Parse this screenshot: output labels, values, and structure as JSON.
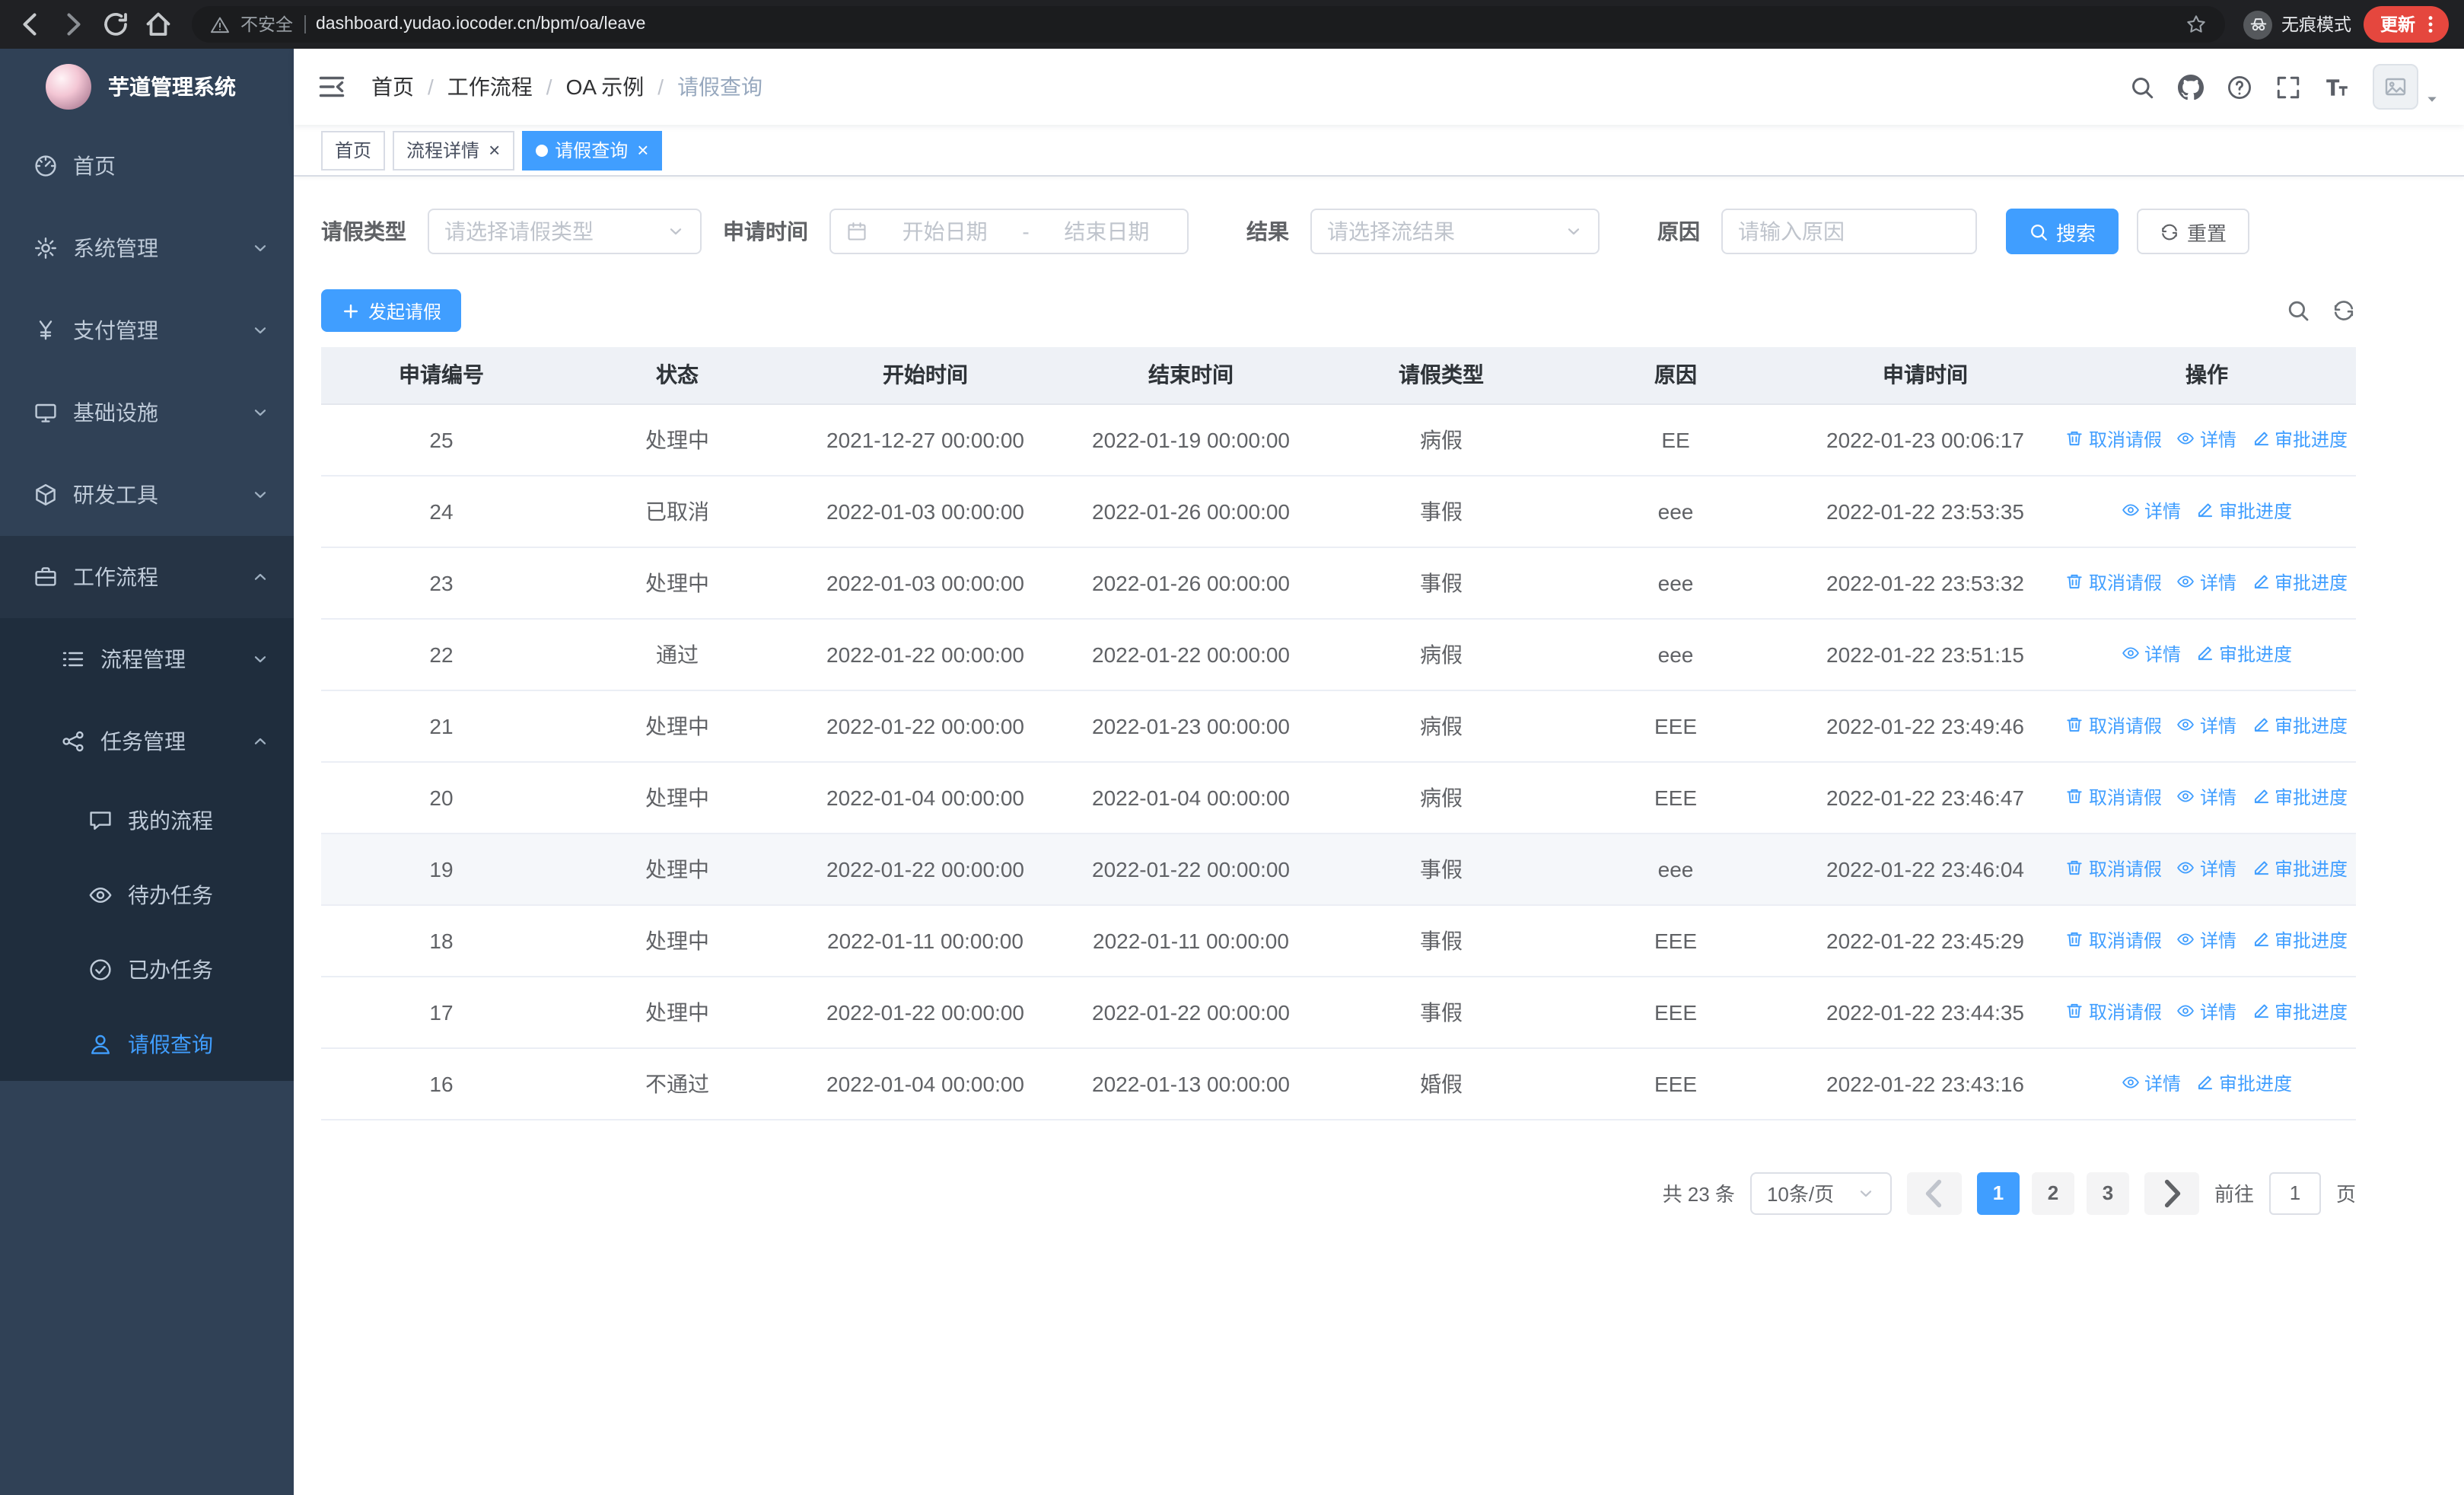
{
  "browser": {
    "security_label": "不安全",
    "url": "dashboard.yudao.iocoder.cn/bpm/oa/leave",
    "incognito_label": "无痕模式",
    "update_label": "更新"
  },
  "sidebar": {
    "app_title": "芋道管理系统",
    "items": [
      {
        "key": "home",
        "label": "首页",
        "icon": "dashboard",
        "level": 1,
        "expandable": false,
        "expanded": false,
        "active": false
      },
      {
        "key": "system-management",
        "label": "系统管理",
        "icon": "gear",
        "level": 1,
        "expandable": true,
        "expanded": false,
        "active": false
      },
      {
        "key": "payment-management",
        "label": "支付管理",
        "icon": "yen",
        "level": 1,
        "expandable": true,
        "expanded": false,
        "active": false
      },
      {
        "key": "infrastructure",
        "label": "基础设施",
        "icon": "monitor",
        "level": 1,
        "expandable": true,
        "expanded": false,
        "active": false
      },
      {
        "key": "dev-tools",
        "label": "研发工具",
        "icon": "cube",
        "level": 1,
        "expandable": true,
        "expanded": false,
        "active": false
      },
      {
        "key": "workflow",
        "label": "工作流程",
        "icon": "briefcase",
        "level": 1,
        "expandable": true,
        "expanded": true,
        "active": false
      },
      {
        "key": "process-management",
        "label": "流程管理",
        "icon": "list",
        "level": 2,
        "expandable": true,
        "expanded": false,
        "active": false
      },
      {
        "key": "task-management",
        "label": "任务管理",
        "icon": "share",
        "level": 2,
        "expandable": true,
        "expanded": true,
        "active": false
      },
      {
        "key": "my-process",
        "label": "我的流程",
        "icon": "chat",
        "level": 3,
        "expandable": false,
        "expanded": false,
        "active": false
      },
      {
        "key": "todo-tasks",
        "label": "待办任务",
        "icon": "eye",
        "level": 3,
        "expandable": false,
        "expanded": false,
        "active": false
      },
      {
        "key": "done-tasks",
        "label": "已办任务",
        "icon": "check",
        "level": 3,
        "expandable": false,
        "expanded": false,
        "active": false
      },
      {
        "key": "leave-query",
        "label": "请假查询",
        "icon": "user",
        "level": 3,
        "expandable": false,
        "expanded": false,
        "active": true
      }
    ]
  },
  "header": {
    "breadcrumb": [
      "首页",
      "工作流程",
      "OA 示例",
      "请假查询"
    ],
    "breadcrumb_separator": "/"
  },
  "tabs": [
    {
      "key": "home",
      "label": "首页",
      "closable": false,
      "active": false
    },
    {
      "key": "process-detail",
      "label": "流程详情",
      "closable": true,
      "active": false
    },
    {
      "key": "leave-query",
      "label": "请假查询",
      "closable": true,
      "active": true
    }
  ],
  "filters": {
    "leave_type_label": "请假类型",
    "leave_type_placeholder": "请选择请假类型",
    "apply_time_label": "申请时间",
    "start_date_placeholder": "开始日期",
    "range_separator": "-",
    "end_date_placeholder": "结束日期",
    "result_label": "结果",
    "result_placeholder": "请选择流结果",
    "reason_label": "原因",
    "reason_placeholder": "请输入原因",
    "search_button": "搜索",
    "reset_button": "重置"
  },
  "toolbar": {
    "create_button": "发起请假"
  },
  "table": {
    "columns": [
      "申请编号",
      "状态",
      "开始时间",
      "结束时间",
      "请假类型",
      "原因",
      "申请时间",
      "操作"
    ],
    "action_labels": {
      "cancel": "取消请假",
      "detail": "详情",
      "progress": "审批进度"
    },
    "rows": [
      {
        "id": "25",
        "status": "处理中",
        "start": "2021-12-27 00:00:00",
        "end": "2022-01-19 00:00:00",
        "type": "病假",
        "reason": "EE",
        "applied": "2022-01-23 00:06:17",
        "actions": [
          "cancel",
          "detail",
          "progress"
        ],
        "highlighted": false
      },
      {
        "id": "24",
        "status": "已取消",
        "start": "2022-01-03 00:00:00",
        "end": "2022-01-26 00:00:00",
        "type": "事假",
        "reason": "eee",
        "applied": "2022-01-22 23:53:35",
        "actions": [
          "detail",
          "progress"
        ],
        "highlighted": false
      },
      {
        "id": "23",
        "status": "处理中",
        "start": "2022-01-03 00:00:00",
        "end": "2022-01-26 00:00:00",
        "type": "事假",
        "reason": "eee",
        "applied": "2022-01-22 23:53:32",
        "actions": [
          "cancel",
          "detail",
          "progress"
        ],
        "highlighted": false
      },
      {
        "id": "22",
        "status": "通过",
        "start": "2022-01-22 00:00:00",
        "end": "2022-01-22 00:00:00",
        "type": "病假",
        "reason": "eee",
        "applied": "2022-01-22 23:51:15",
        "actions": [
          "detail",
          "progress"
        ],
        "highlighted": false
      },
      {
        "id": "21",
        "status": "处理中",
        "start": "2022-01-22 00:00:00",
        "end": "2022-01-23 00:00:00",
        "type": "病假",
        "reason": "EEE",
        "applied": "2022-01-22 23:49:46",
        "actions": [
          "cancel",
          "detail",
          "progress"
        ],
        "highlighted": false
      },
      {
        "id": "20",
        "status": "处理中",
        "start": "2022-01-04 00:00:00",
        "end": "2022-01-04 00:00:00",
        "type": "病假",
        "reason": "EEE",
        "applied": "2022-01-22 23:46:47",
        "actions": [
          "cancel",
          "detail",
          "progress"
        ],
        "highlighted": false
      },
      {
        "id": "19",
        "status": "处理中",
        "start": "2022-01-22 00:00:00",
        "end": "2022-01-22 00:00:00",
        "type": "事假",
        "reason": "eee",
        "applied": "2022-01-22 23:46:04",
        "actions": [
          "cancel",
          "detail",
          "progress"
        ],
        "highlighted": true
      },
      {
        "id": "18",
        "status": "处理中",
        "start": "2022-01-11 00:00:00",
        "end": "2022-01-11 00:00:00",
        "type": "事假",
        "reason": "EEE",
        "applied": "2022-01-22 23:45:29",
        "actions": [
          "cancel",
          "detail",
          "progress"
        ],
        "highlighted": false
      },
      {
        "id": "17",
        "status": "处理中",
        "start": "2022-01-22 00:00:00",
        "end": "2022-01-22 00:00:00",
        "type": "事假",
        "reason": "EEE",
        "applied": "2022-01-22 23:44:35",
        "actions": [
          "cancel",
          "detail",
          "progress"
        ],
        "highlighted": false
      },
      {
        "id": "16",
        "status": "不通过",
        "start": "2022-01-04 00:00:00",
        "end": "2022-01-13 00:00:00",
        "type": "婚假",
        "reason": "EEE",
        "applied": "2022-01-22 23:43:16",
        "actions": [
          "detail",
          "progress"
        ],
        "highlighted": false
      }
    ]
  },
  "pagination": {
    "total_label": "共 23 条",
    "page_size": "10条/页",
    "pages": [
      "1",
      "2",
      "3"
    ],
    "active_page": "1",
    "goto_label": "前往",
    "goto_value": "1",
    "page_suffix_label": "页"
  },
  "colors": {
    "accent": "#409eff",
    "sidebar_bg": "#304156",
    "sidebar_submenu_bg": "#1f2d3d",
    "sidebar_text": "#bfcbd9",
    "table_header_bg": "#eef1f6",
    "update_badge_bg": "#e5473e",
    "browser_chrome_bg": "#202124"
  }
}
